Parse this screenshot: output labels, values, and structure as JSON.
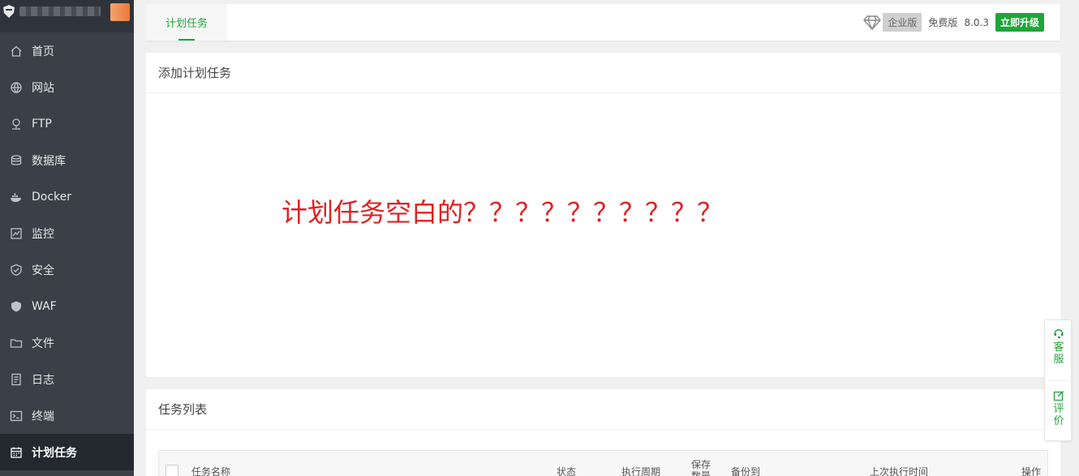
{
  "sidebar": {
    "items": [
      {
        "label": "首页",
        "icon": "home-icon"
      },
      {
        "label": "网站",
        "icon": "globe-icon"
      },
      {
        "label": "FTP",
        "icon": "ftp-icon"
      },
      {
        "label": "数据库",
        "icon": "database-icon"
      },
      {
        "label": "Docker",
        "icon": "docker-icon"
      },
      {
        "label": "监控",
        "icon": "monitor-icon"
      },
      {
        "label": "安全",
        "icon": "shield-check-icon"
      },
      {
        "label": "WAF",
        "icon": "shield-icon"
      },
      {
        "label": "文件",
        "icon": "folder-icon"
      },
      {
        "label": "日志",
        "icon": "log-icon"
      },
      {
        "label": "终端",
        "icon": "terminal-icon"
      },
      {
        "label": "计划任务",
        "icon": "calendar-icon",
        "active": true
      }
    ]
  },
  "topbar": {
    "tab_label": "计划任务",
    "enterprise_label": "企业版",
    "free_label": "免费版",
    "version": "8.0.3",
    "upgrade_label": "立即升级"
  },
  "add_panel": {
    "title": "添加计划任务",
    "annotation": "计划任务空白的？？？？？？？？？？"
  },
  "list_panel": {
    "title": "任务列表",
    "columns": [
      "任务名称",
      "状态",
      "执行周期",
      "保存数量",
      "备份到",
      "上次执行时间",
      "操作"
    ]
  },
  "float_widget": {
    "service_label": "客服",
    "review_label": "评价"
  },
  "colors": {
    "accent": "#20a53a",
    "sidebar_bg": "#3a3f48",
    "annotation": "#e02020"
  }
}
